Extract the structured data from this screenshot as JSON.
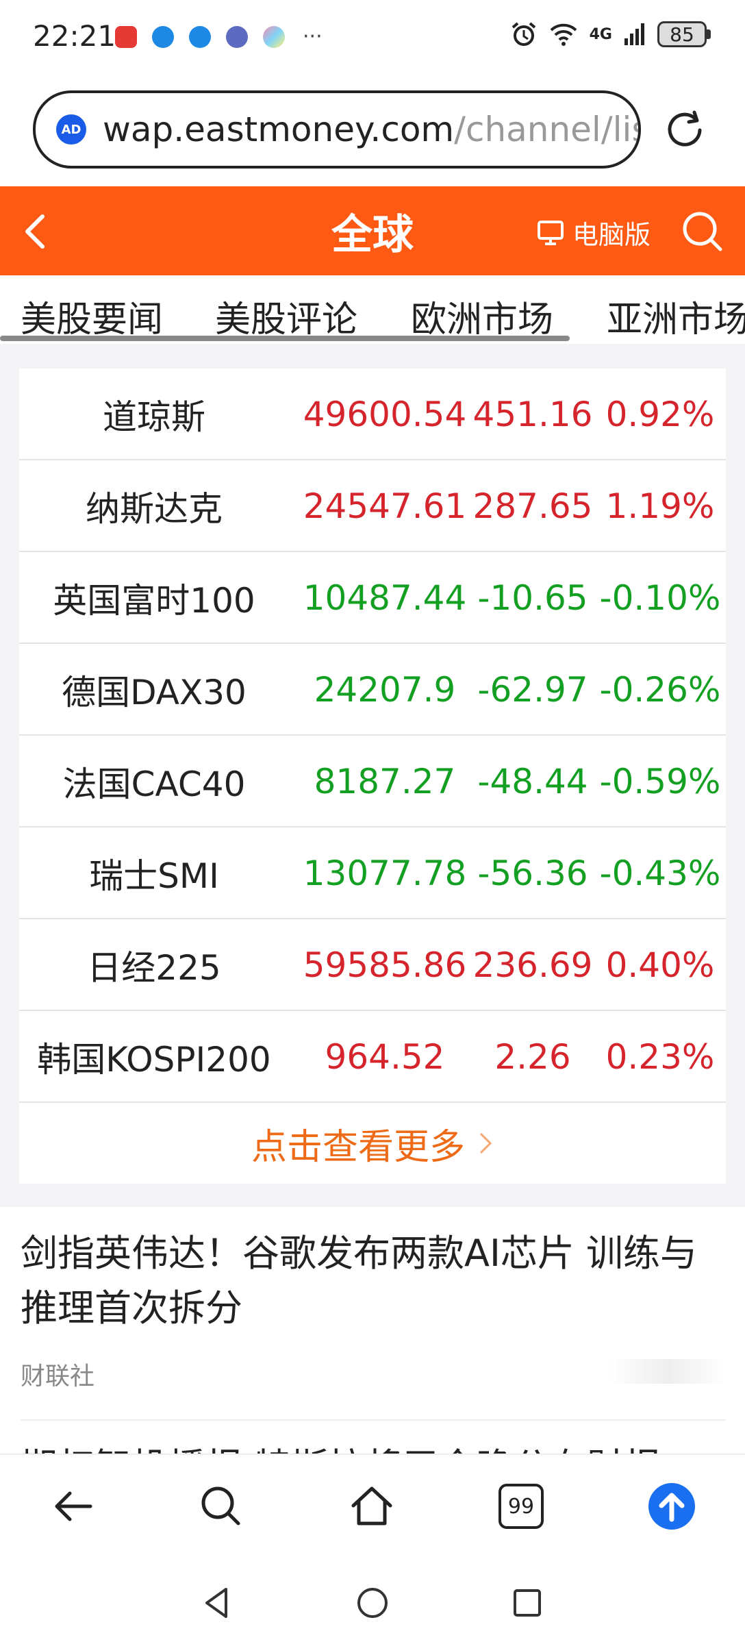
{
  "status_bar": {
    "time": "22:21",
    "more": "···",
    "battery": "85",
    "network": "4G"
  },
  "browser": {
    "url_domain": "wap.eastmoney.com",
    "url_path": "/channel/lis",
    "ad_badge": "AD"
  },
  "header": {
    "title": "全球",
    "pc_label": "电脑版"
  },
  "tabs": [
    {
      "label": "美股要闻"
    },
    {
      "label": "美股评论"
    },
    {
      "label": "欧洲市场"
    },
    {
      "label": "亚洲市场"
    }
  ],
  "indices": [
    {
      "name": "道琼斯",
      "price": "49600.54",
      "change": "451.16",
      "pct": "0.92%",
      "trend": "up"
    },
    {
      "name": "纳斯达克",
      "price": "24547.61",
      "change": "287.65",
      "pct": "1.19%",
      "trend": "up"
    },
    {
      "name": "英国富时100",
      "price": "10487.44",
      "change": "-10.65",
      "pct": "-0.10%",
      "trend": "down"
    },
    {
      "name": "德国DAX30",
      "price": "24207.9",
      "change": "-62.97",
      "pct": "-0.26%",
      "trend": "down"
    },
    {
      "name": "法国CAC40",
      "price": "8187.27",
      "change": "-48.44",
      "pct": "-0.59%",
      "trend": "down"
    },
    {
      "name": "瑞士SMI",
      "price": "13077.78",
      "change": "-56.36",
      "pct": "-0.43%",
      "trend": "down"
    },
    {
      "name": "日经225",
      "price": "59585.86",
      "change": "236.69",
      "pct": "0.40%",
      "trend": "up"
    },
    {
      "name": "韩国KOSPI200",
      "price": "964.52",
      "change": "2.26",
      "pct": "0.23%",
      "trend": "up"
    }
  ],
  "more_link": "点击查看更多",
  "news": [
    {
      "title": "剑指英伟达！谷歌发布两款AI芯片 训练与推理首次拆分",
      "source": "财联社"
    },
    {
      "title": "期权智投播报 特斯拉将于今晚公布财报",
      "source": ""
    }
  ],
  "colors": {
    "brand": "#ff5a14",
    "up": "#d6242c",
    "down": "#13a022",
    "more_link": "#ee6a16",
    "fab": "#1a6ff0"
  },
  "bottom_bar": {
    "tab_count": "99"
  }
}
